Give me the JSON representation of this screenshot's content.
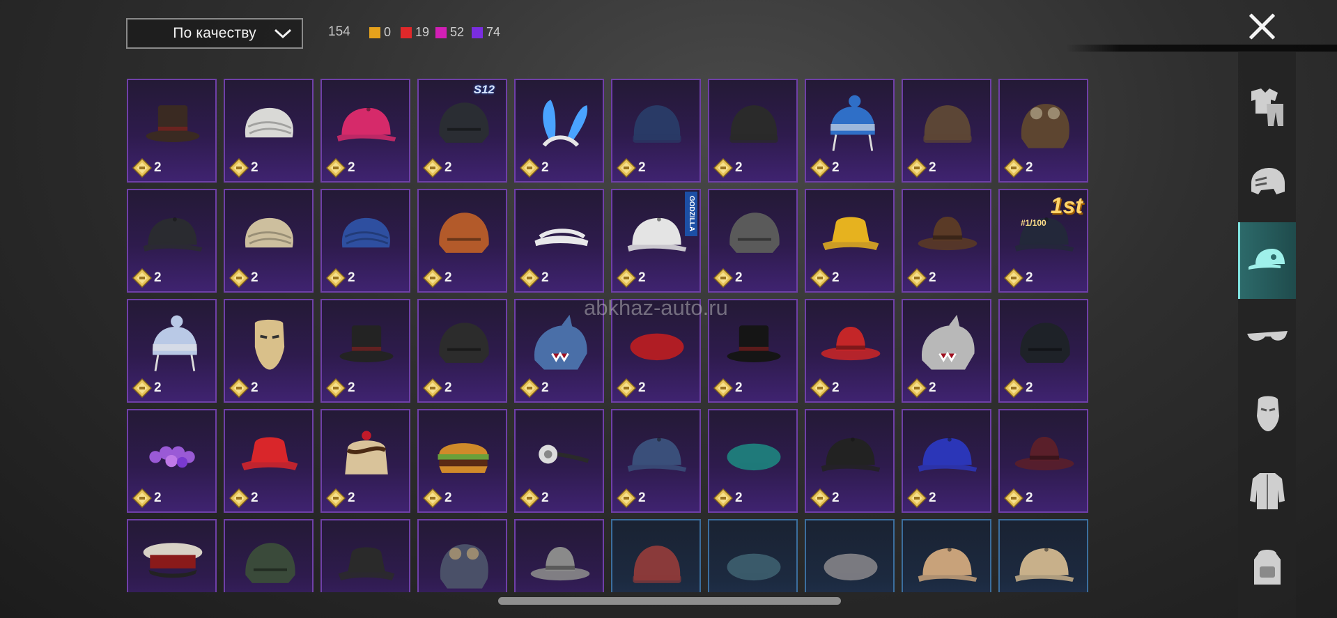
{
  "toolbar": {
    "sort_label": "По качеству",
    "total_count": "154",
    "rarity_counts": [
      {
        "color": "#e6a21c",
        "count": "0"
      },
      {
        "color": "#e0282a",
        "count": "19"
      },
      {
        "color": "#d21fb6",
        "count": "52"
      },
      {
        "color": "#7a2de0",
        "count": "74"
      }
    ]
  },
  "watermark": "abkhaz-auto.ru",
  "items": [
    {
      "name": "top-hat-leather",
      "qty": "2",
      "icon": "tophat",
      "color": "#3a2a22"
    },
    {
      "name": "turban-white",
      "qty": "2",
      "icon": "turban",
      "color": "#d9d9d6"
    },
    {
      "name": "cap-pink",
      "qty": "2",
      "icon": "cap",
      "color": "#d62a6a"
    },
    {
      "name": "helmet-s12",
      "qty": "2",
      "icon": "helmet",
      "color": "#2a2d33",
      "tag": "S12"
    },
    {
      "name": "bunny-ears",
      "qty": "2",
      "icon": "ears",
      "color": "#4aa3ff"
    },
    {
      "name": "beanie-navy",
      "qty": "2",
      "icon": "beanie",
      "color": "#293a66"
    },
    {
      "name": "cap-black-flap",
      "qty": "2",
      "icon": "beanie",
      "color": "#2a2a2a"
    },
    {
      "name": "winter-hat-blue",
      "qty": "2",
      "icon": "pompom",
      "color": "#2f6fc7"
    },
    {
      "name": "beanie-brown",
      "qty": "2",
      "icon": "beanie",
      "color": "#5c4636"
    },
    {
      "name": "aviator-goggles",
      "qty": "2",
      "icon": "aviator",
      "color": "#5d4530"
    },
    {
      "name": "cap-black",
      "qty": "2",
      "icon": "cap",
      "color": "#2a2b30"
    },
    {
      "name": "turban-cream",
      "qty": "2",
      "icon": "turban",
      "color": "#cdbf9e"
    },
    {
      "name": "turban-blue",
      "qty": "2",
      "icon": "turban",
      "color": "#2e4fa0"
    },
    {
      "name": "football-helmet",
      "qty": "2",
      "icon": "helmet",
      "color": "#b35a2a"
    },
    {
      "name": "visor-white",
      "qty": "2",
      "icon": "visor",
      "color": "#e8e8ea"
    },
    {
      "name": "cap-white-godzilla",
      "qty": "2",
      "icon": "cap",
      "color": "#e4e4e4",
      "tag": "GODZILLA"
    },
    {
      "name": "pith-helmet-grey",
      "qty": "2",
      "icon": "helmet",
      "color": "#5a5a5a"
    },
    {
      "name": "bucket-yellow",
      "qty": "2",
      "icon": "bucket",
      "color": "#e6b21f"
    },
    {
      "name": "cowboy-brown",
      "qty": "2",
      "icon": "fedora",
      "color": "#5a3a26"
    },
    {
      "name": "cap-1st",
      "qty": "2",
      "icon": "cap",
      "color": "#23283a",
      "tag": "1st",
      "rank": "#1/100"
    },
    {
      "name": "winter-hat-white",
      "qty": "2",
      "icon": "pompom",
      "color": "#b9c9e6"
    },
    {
      "name": "venetian-mask",
      "qty": "2",
      "icon": "mask",
      "color": "#d9c08a"
    },
    {
      "name": "top-hat-red-band",
      "qty": "2",
      "icon": "tophat",
      "color": "#232323"
    },
    {
      "name": "wrestler-mask",
      "qty": "2",
      "icon": "helmet",
      "color": "#2c2c2c"
    },
    {
      "name": "shark-hood-blue",
      "qty": "2",
      "icon": "shark",
      "color": "#4a6fa8"
    },
    {
      "name": "beret-red",
      "qty": "2",
      "icon": "beret",
      "color": "#b01d24"
    },
    {
      "name": "top-hat-black",
      "qty": "2",
      "icon": "tophat",
      "color": "#151515"
    },
    {
      "name": "fedora-red",
      "qty": "2",
      "icon": "fedora",
      "color": "#c42628"
    },
    {
      "name": "shark-hood-grey",
      "qty": "2",
      "icon": "shark",
      "color": "#b8b8b8"
    },
    {
      "name": "headset-helmet",
      "qty": "2",
      "icon": "helmet",
      "color": "#1e2228"
    },
    {
      "name": "flower-crown",
      "qty": "2",
      "icon": "flowers",
      "color": "#9a5ad6"
    },
    {
      "name": "bucket-red",
      "qty": "2",
      "icon": "bucket",
      "color": "#d9262a"
    },
    {
      "name": "cake-hat",
      "qty": "2",
      "icon": "cake",
      "color": "#d9c39a"
    },
    {
      "name": "burger-hat",
      "qty": "2",
      "icon": "burger",
      "color": "#d08a2a"
    },
    {
      "name": "head-mirror",
      "qty": "2",
      "icon": "mirror",
      "color": "#dcdcdc"
    },
    {
      "name": "cap-soviet-blue",
      "qty": "2",
      "icon": "cap",
      "color": "#3a4f7a"
    },
    {
      "name": "beret-teal",
      "qty": "2",
      "icon": "beret",
      "color": "#1f7a7a"
    },
    {
      "name": "cap-black-print",
      "qty": "2",
      "icon": "cap",
      "color": "#222222"
    },
    {
      "name": "cap-blue",
      "qty": "2",
      "icon": "cap",
      "color": "#2b36b8"
    },
    {
      "name": "fedora-burgundy",
      "qty": "2",
      "icon": "fedora",
      "color": "#5a1f2a"
    },
    {
      "name": "officer-cap",
      "qty": "2",
      "icon": "officer",
      "color": "#d8d2c6"
    },
    {
      "name": "helmet-net",
      "qty": "2",
      "icon": "helmet",
      "color": "#3a4a3a"
    },
    {
      "name": "bucket-black-print",
      "qty": "2",
      "icon": "bucket",
      "color": "#2a2a2a"
    },
    {
      "name": "pilot-cap",
      "qty": "2",
      "icon": "aviator",
      "color": "#4a5068"
    },
    {
      "name": "fedora-grey-feather",
      "qty": "2",
      "icon": "fedora",
      "color": "#8a8a8a"
    },
    {
      "name": "bandana-red",
      "qty": "2",
      "icon": "beanie",
      "color": "#8a3a3a",
      "rarity": "blue"
    },
    {
      "name": "beret-blue-grey",
      "qty": "2",
      "icon": "beret",
      "color": "#3a5a6a",
      "rarity": "blue"
    },
    {
      "name": "flat-cap-grey",
      "qty": "2",
      "icon": "beret",
      "color": "#7a7a80",
      "rarity": "blue"
    },
    {
      "name": "cap-tan-red",
      "qty": "2",
      "icon": "cap",
      "color": "#c8a27a",
      "rarity": "blue"
    },
    {
      "name": "cap-tan-blue",
      "qty": "2",
      "icon": "cap",
      "color": "#c8b08a",
      "rarity": "blue"
    }
  ],
  "sidebar": {
    "tabs": [
      {
        "name": "outfit",
        "icon": "outfit-icon"
      },
      {
        "name": "helmet",
        "icon": "helmet-icon"
      },
      {
        "name": "hat",
        "icon": "cap-icon",
        "active": true
      },
      {
        "name": "glasses",
        "icon": "glasses-icon"
      },
      {
        "name": "mask",
        "icon": "mask-icon"
      },
      {
        "name": "jacket",
        "icon": "jacket-icon"
      },
      {
        "name": "backpack",
        "icon": "backpack-icon"
      }
    ]
  }
}
